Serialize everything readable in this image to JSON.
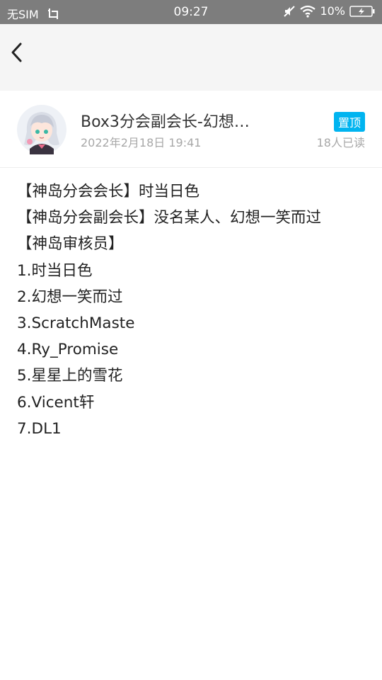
{
  "status_bar": {
    "carrier": "无SIM",
    "time": "09:27",
    "battery": "10%"
  },
  "nav": {
    "back_icon": "chevron-left-icon"
  },
  "post": {
    "title": "Box3分会副会长-幻想…",
    "date": "2022年2月18日 19:41",
    "pinned_label": "置顶",
    "read_count": "18人已读",
    "lines": [
      "【神岛分会会长】时当日色",
      "【神岛分会副会长】没名某人、幻想一笑而过",
      "【神岛审核员】",
      "1.时当日色",
      "2.幻想一笑而过",
      "3.ScratchMaste",
      "4.Ry_Promise",
      "5.星星上的雪花",
      "6.Vicent轩",
      "7.DL1"
    ]
  },
  "colors": {
    "status_bar_bg": "#7d7d7d",
    "nav_bg": "#f5f5f5",
    "badge_bg": "#00b4f0"
  }
}
